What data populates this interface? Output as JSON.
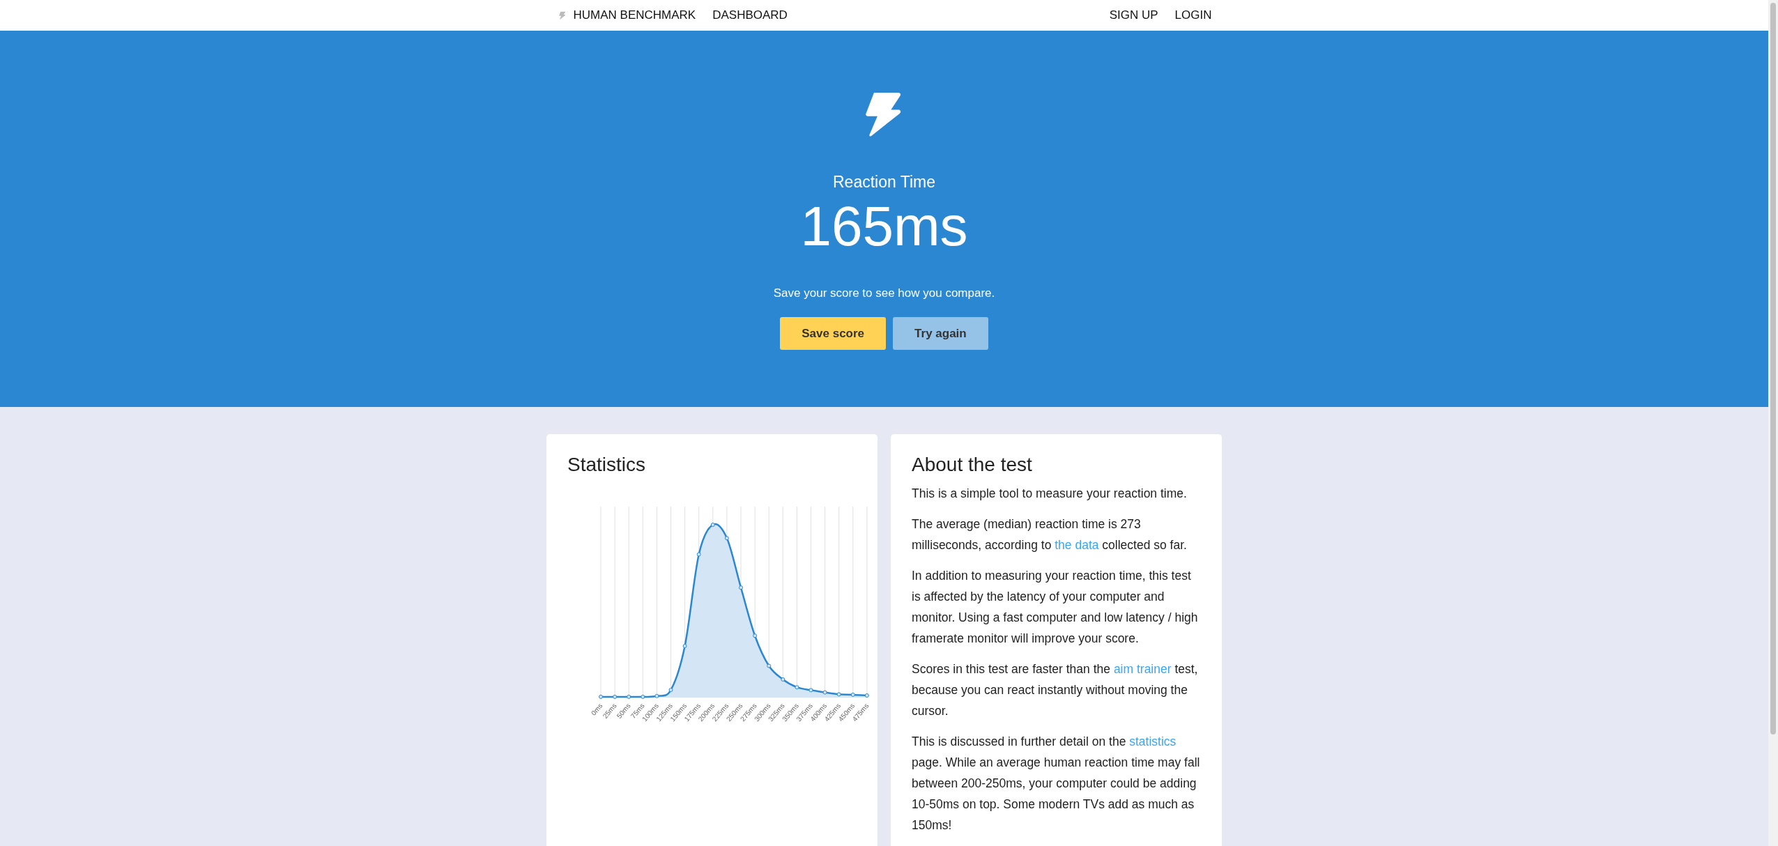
{
  "nav": {
    "brand": "HUMAN BENCHMARK",
    "left_links": [
      "DASHBOARD"
    ],
    "right_links": [
      "SIGN UP",
      "LOGIN"
    ]
  },
  "hero": {
    "title": "Reaction Time",
    "result": "165ms",
    "subtitle": "Save your score to see how you compare.",
    "buttons": [
      {
        "label": "Save score",
        "kind": "primary"
      },
      {
        "label": "Try again",
        "kind": "secondary"
      }
    ]
  },
  "statistics": {
    "title": "Statistics",
    "x_labels": [
      "0ms",
      "25ms",
      "50ms",
      "75ms",
      "100ms",
      "125ms",
      "150ms",
      "175ms",
      "200ms",
      "225ms",
      "250ms",
      "275ms",
      "300ms",
      "325ms",
      "350ms",
      "375ms",
      "400ms",
      "425ms",
      "450ms",
      "475ms"
    ]
  },
  "about": {
    "title": "About the test",
    "paragraphs": [
      [
        {
          "kind": "text",
          "text": "This is a simple tool to measure your reaction time."
        }
      ],
      [
        {
          "kind": "text",
          "text": "The average (median) reaction time is 273 milliseconds, according to "
        },
        {
          "kind": "link",
          "text": "the data"
        },
        {
          "kind": "text",
          "text": " collected so far."
        }
      ],
      [
        {
          "kind": "text",
          "text": "In addition to measuring your reaction time, this test is affected by the latency of your computer and monitor. Using a fast computer and low latency / high framerate monitor will improve your score."
        }
      ],
      [
        {
          "kind": "text",
          "text": "Scores in this test are faster than the "
        },
        {
          "kind": "link",
          "text": "aim trainer"
        },
        {
          "kind": "text",
          "text": " test, because you can react instantly without moving the cursor."
        }
      ],
      [
        {
          "kind": "text",
          "text": "This is discussed in further detail on the "
        },
        {
          "kind": "link",
          "text": "statistics"
        },
        {
          "kind": "text",
          "text": " page. While an average human reaction time may fall between 200-250ms, your computer could be adding 10-50ms on top. Some modern TVs add as much as 150ms!"
        }
      ]
    ]
  }
}
